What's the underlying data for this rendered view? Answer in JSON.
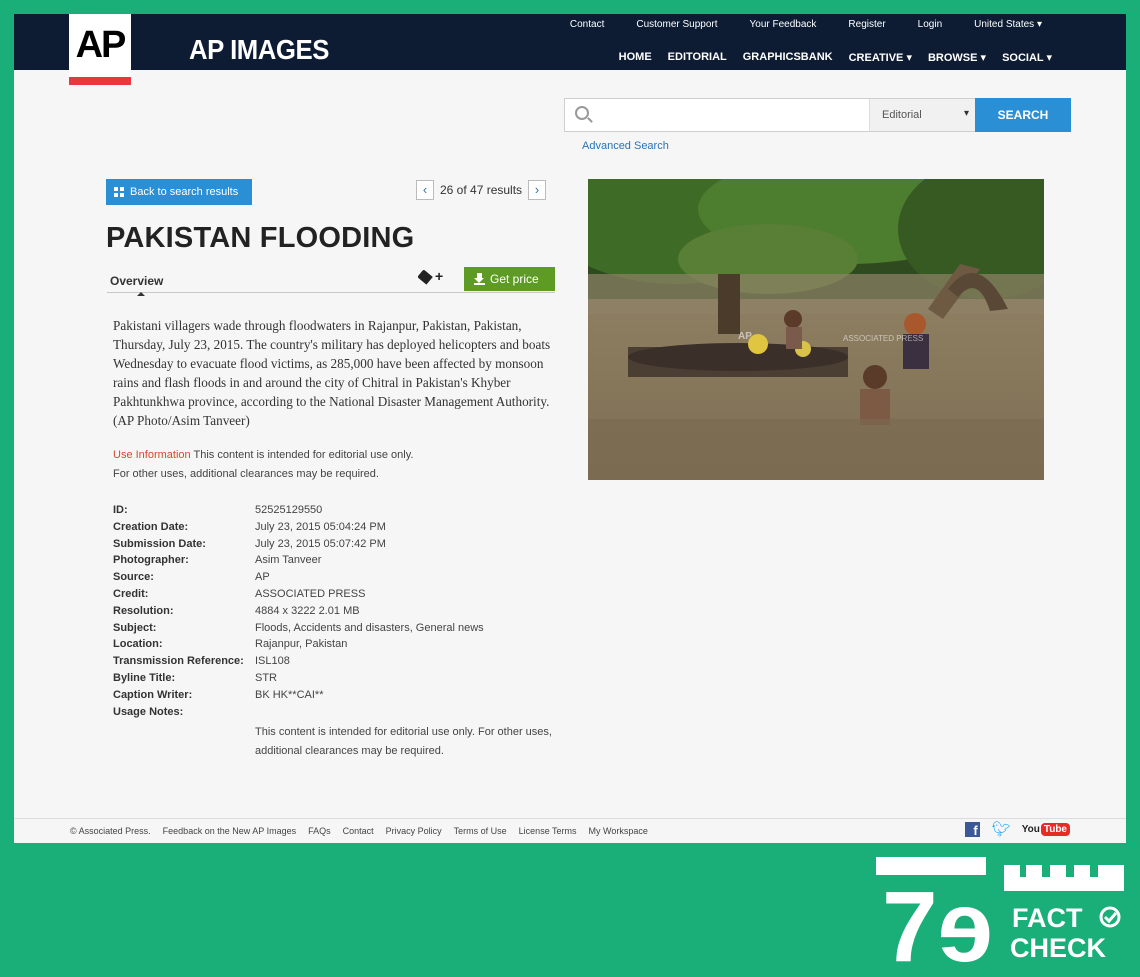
{
  "header": {
    "logo_text": "AP",
    "brand": "AP IMAGES",
    "util_nav": [
      "Contact",
      "Customer Support",
      "Your Feedback",
      "Register",
      "Login"
    ],
    "country": "United States",
    "main_nav": [
      {
        "label": "HOME",
        "dropdown": false
      },
      {
        "label": "EDITORIAL",
        "dropdown": false
      },
      {
        "label": "GRAPHICSBANK",
        "dropdown": false
      },
      {
        "label": "CREATIVE",
        "dropdown": true
      },
      {
        "label": "BROWSE",
        "dropdown": true
      },
      {
        "label": "SOCIAL",
        "dropdown": true
      }
    ]
  },
  "search": {
    "value": "",
    "scope": "Editorial",
    "button": "SEARCH",
    "advanced": "Advanced Search"
  },
  "nav": {
    "back": "Back to search results",
    "pager": "26  of  47 results",
    "prev": "‹",
    "next": "›"
  },
  "asset": {
    "title": "PAKISTAN FLOODING",
    "tab": "Overview",
    "price_button": "Get price",
    "caption": "Pakistani villagers wade through floodwaters in Rajanpur, Pakistan, Pakistan, Thursday, July 23, 2015. The country's military has deployed helicopters and boats Wednesday to evacuate flood victims, as 285,000 have been affected by monsoon rains and flash floods in and around the city of Chitral in Pakistan's Khyber Pakhtunkhwa province, according to the National Disaster Management Authority. (AP Photo/Asim Tanveer)",
    "use_info_label": "Use Information",
    "use_info_text": " This content is intended for editorial use only.",
    "use_info_text2": "For other uses, additional clearances may be required.",
    "watermark": "ASSOCIATED PRESS",
    "watermark_logo": "AP"
  },
  "meta": [
    {
      "k": "ID:",
      "v": "52525129550"
    },
    {
      "k": "Creation Date:",
      "v": "July 23, 2015 05:04:24 PM"
    },
    {
      "k": "Submission Date:",
      "v": "July 23, 2015 05:07:42 PM"
    },
    {
      "k": "Photographer:",
      "v": "Asim Tanveer"
    },
    {
      "k": "Source:",
      "v": "AP"
    },
    {
      "k": "Credit:",
      "v": "ASSOCIATED PRESS"
    },
    {
      "k": "Resolution:",
      "v": "4884 x 3222 2.01 MB"
    },
    {
      "k": "Subject:",
      "v": "Floods, Accidents and disasters, General news"
    },
    {
      "k": "Location:",
      "v": "Rajanpur, Pakistan"
    },
    {
      "k": "Transmission Reference:",
      "v": "ISL108"
    },
    {
      "k": "Byline Title:",
      "v": "STR"
    },
    {
      "k": "Caption Writer:",
      "v": "BK HK**CAI**"
    },
    {
      "k": "Usage Notes:",
      "v": ""
    }
  ],
  "usage_notes": "This content is intended for editorial use only. For other uses, additional clearances may be required.",
  "footer": {
    "links": [
      "© Associated Press.",
      "Feedback on the New AP Images",
      "FAQs",
      "Contact",
      "Privacy Policy",
      "Terms of Use",
      "License Terms",
      "My Workspace"
    ],
    "youtube_a": "You",
    "youtube_b": "Tube"
  },
  "badge": {
    "line1": "FACT",
    "line2": "CHECK",
    "numeral": "7ɘ"
  },
  "colors": {
    "background": "#1aaf78",
    "header": "#0d1c33",
    "accent_blue": "#2a8fd5",
    "price_green": "#5e9b24",
    "ap_red": "#e8373d"
  }
}
